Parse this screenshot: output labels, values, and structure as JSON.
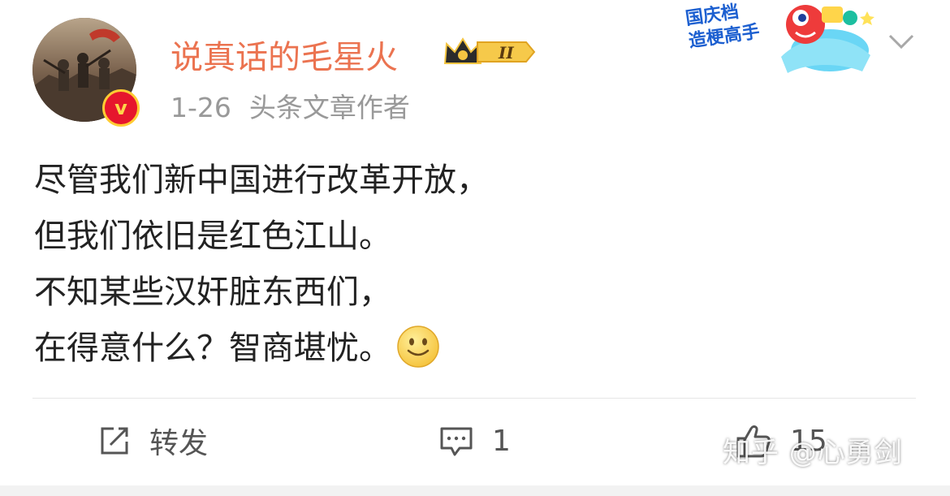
{
  "post": {
    "username": "说真话的毛星火",
    "level_badge": "II",
    "date": "1-26",
    "source": "头条文章作者",
    "content_lines": [
      "尽管我们新中国进行改革开放，",
      "但我们依旧是红色江山。",
      "不知某些汉奸脏东西们，",
      "在得意什么？智商堪忧。"
    ],
    "emoji": "smile-emoji"
  },
  "promo": {
    "text": "国庆档\n造梗高手"
  },
  "actions": {
    "repost_label": "转发",
    "comment_count": "1",
    "like_count": "15"
  },
  "watermark": {
    "text": "知乎 @心勇剑"
  },
  "colors": {
    "username": "#eb7350",
    "meta": "#999999",
    "content": "#222222",
    "action": "#555555",
    "verified_badge": "#e6162d"
  },
  "icons": [
    "verified-icon",
    "crown-level-badge-icon",
    "chevron-down-icon",
    "smile-emoji-icon",
    "repost-icon",
    "comment-icon",
    "like-icon"
  ]
}
